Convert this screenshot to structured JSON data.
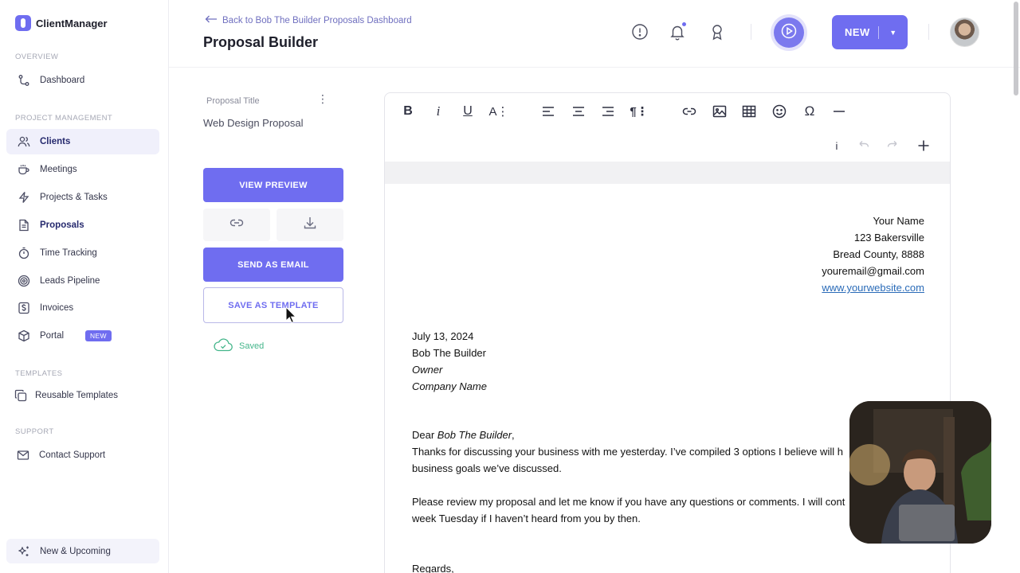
{
  "brand": {
    "name": "ClientManager"
  },
  "sidebar": {
    "overview_label": "OVERVIEW",
    "project_label": "PROJECT MANAGEMENT",
    "templates_label": "TEMPLATES",
    "support_label": "SUPPORT",
    "items": [
      {
        "label": "Dashboard",
        "icon": "route-icon"
      },
      {
        "label": "Clients",
        "icon": "users-icon"
      },
      {
        "label": "Meetings",
        "icon": "coffee-icon"
      },
      {
        "label": "Projects & Tasks",
        "icon": "bolt-icon"
      },
      {
        "label": "Proposals",
        "icon": "document-icon"
      },
      {
        "label": "Time Tracking",
        "icon": "stopwatch-icon"
      },
      {
        "label": "Leads Pipeline",
        "icon": "target-icon"
      },
      {
        "label": "Invoices",
        "icon": "dollar-icon"
      },
      {
        "label": "Portal",
        "icon": "box-icon",
        "badge": "NEW"
      },
      {
        "label": "Reusable Templates",
        "icon": "copy-icon"
      },
      {
        "label": "Contact Support",
        "icon": "mail-icon"
      },
      {
        "label": "New & Upcoming",
        "icon": "sparkle-icon"
      }
    ]
  },
  "header": {
    "back_link": "Back to Bob The Builder Proposals Dashboard",
    "title": "Proposal Builder",
    "new_button": "NEW"
  },
  "panel": {
    "title_label": "Proposal Title",
    "title_value": "Web Design Proposal",
    "view_preview": "VIEW PREVIEW",
    "send_email": "SEND AS EMAIL",
    "save_template": "SAVE AS TEMPLATE",
    "saved": "Saved"
  },
  "toolbar": {
    "info": "i",
    "special_char": "Ω"
  },
  "document": {
    "sender": {
      "name": "Your Name",
      "street": "123 Bakersville",
      "county": "Bread County, 8888",
      "email": "youremail@gmail.com",
      "website": "www.yourwebsite.com"
    },
    "date": "July 13, 2024",
    "recipient_name": "Bob The Builder",
    "recipient_title": "Owner",
    "recipient_company": "Company Name",
    "greeting_prefix": "Dear ",
    "greeting_name": "Bob The Builder",
    "greeting_suffix": ",",
    "para1_line1": "Thanks for discussing your business with me yesterday. I’ve compiled 3 options I believe will h",
    "para1_line2": "business goals we’ve discussed.",
    "para2_line1": "Please review my proposal and let me know if you have any questions or comments. I will cont",
    "para2_line2": "week Tuesday if I haven’t heard from you by then.",
    "closing": "Regards,"
  },
  "colors": {
    "accent": "#6f6df0",
    "saved": "#43b58a",
    "link": "#2a6bb8"
  }
}
